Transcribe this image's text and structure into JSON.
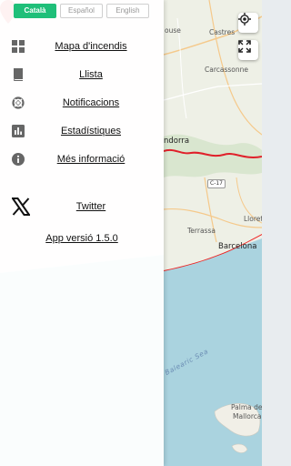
{
  "language_selector": {
    "options": [
      "Català",
      "Español",
      "English"
    ],
    "selected": "Català",
    "active_color": "#1fbf79"
  },
  "menu": {
    "items": [
      {
        "label": "Mapa d'incendis",
        "icon": "grid-icon"
      },
      {
        "label": "Llista",
        "icon": "book-icon"
      },
      {
        "label": "Notificacions",
        "icon": "lifebuoy-icon"
      },
      {
        "label": "Estadístiques",
        "icon": "bar-chart-icon"
      },
      {
        "label": "Més informació",
        "icon": "info-icon"
      },
      {
        "label": "Twitter",
        "icon": "x-logo-icon"
      }
    ],
    "version": "App versió 1.5.0"
  },
  "map": {
    "labels": {
      "ouse": "ouse",
      "castres": "Castres",
      "carcassonne": "Carcassonne",
      "andorra": "ndorra",
      "c17": "C-17",
      "terrassa": "Terrassa",
      "barcelona": "Barcelona",
      "llorete": "Llorete",
      "balearic": "Balearic Sea",
      "palma": "Palma de Mallorca",
      "mallorca_short": "Mallorca"
    },
    "controls": [
      "locate-icon",
      "fullscreen-icon"
    ],
    "fire_color": "#e8262b",
    "border_color": "#e0202a"
  }
}
